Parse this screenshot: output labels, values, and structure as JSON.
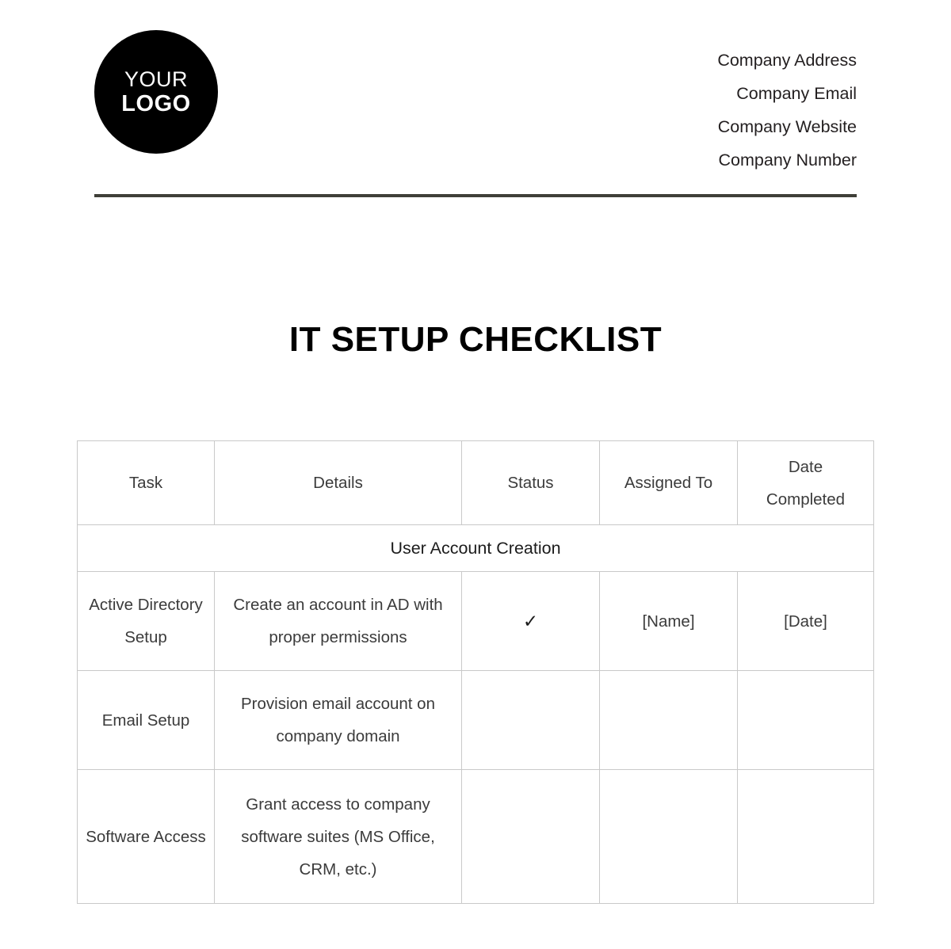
{
  "header": {
    "logo": {
      "line1": "YOUR",
      "line2": "LOGO"
    },
    "company": [
      "Company Address",
      "Company Email",
      "Company Website",
      "Company Number"
    ]
  },
  "title": "IT SETUP CHECKLIST",
  "table": {
    "columns": [
      "Task",
      "Details",
      "Status",
      "Assigned To",
      "Date Completed"
    ],
    "columns_display": {
      "task": "Task",
      "details": "Details",
      "status": "Status",
      "assigned_to": "Assigned To",
      "date_completed_line1": "Date",
      "date_completed_line2": "Completed"
    },
    "sections": [
      {
        "title": "User Account Creation",
        "rows": [
          {
            "task": "Active Directory Setup",
            "details": "Create an account in AD with proper permissions",
            "status": "✓",
            "assigned_to": "[Name]",
            "date_completed": "[Date]"
          },
          {
            "task": "Email Setup",
            "details": "Provision email account on company domain",
            "status": "",
            "assigned_to": "",
            "date_completed": ""
          },
          {
            "task": "Software Access",
            "details": "Grant access to company software suites (MS Office, CRM, etc.)",
            "status": "",
            "assigned_to": "",
            "date_completed": ""
          }
        ]
      }
    ]
  },
  "colors": {
    "rule": "#3f3f38",
    "logo_bg": "#000000",
    "grid": "#c9c9c9",
    "text": "#231f20"
  }
}
